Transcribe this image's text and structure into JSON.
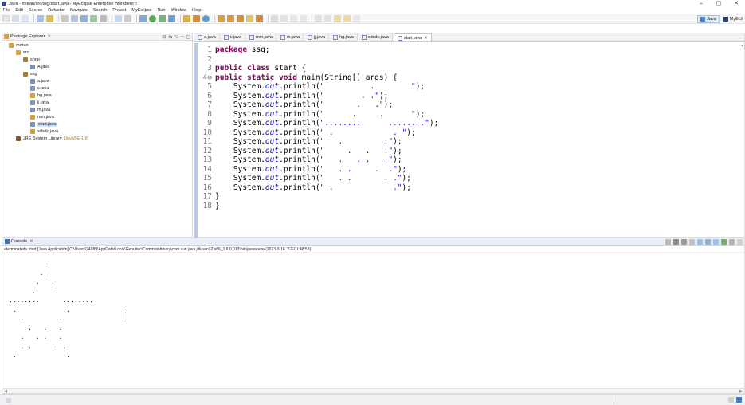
{
  "window": {
    "title": "Java - moran/src/ssg/start.java - MyEclipse Enterprise Workbench",
    "minimize_glyph": "–",
    "maximize_glyph": "▢",
    "close_glyph": "✕"
  },
  "menu": [
    "File",
    "Edit",
    "Source",
    "Refactor",
    "Navigate",
    "Search",
    "Project",
    "MyEclipse",
    "Run",
    "Window",
    "Help"
  ],
  "perspectives": [
    {
      "label": "Java",
      "icon": "java-perspective-icon",
      "active": true
    },
    {
      "label": "MyEcli",
      "icon": "myeclipse-perspective-icon",
      "active": false
    }
  ],
  "package_explorer": {
    "title": "Package Explorer",
    "close_glyph": "✕",
    "tools": [
      "⊟",
      "⇆",
      "▽",
      "–",
      "▢"
    ],
    "tree": [
      {
        "label": "moran",
        "icon": "project-icon",
        "depth": 0,
        "color": "#c9a23c"
      },
      {
        "label": "src",
        "icon": "source-folder-icon",
        "depth": 1,
        "color": "#d4a93d"
      },
      {
        "label": "shop",
        "icon": "package-icon",
        "depth": 2,
        "color": "#a37c3a"
      },
      {
        "label": "A.java",
        "icon": "java-file-icon",
        "depth": 3,
        "color": "#7a90b4"
      },
      {
        "label": "ssg",
        "icon": "package-icon",
        "depth": 2,
        "color": "#a37c3a"
      },
      {
        "label": "a.java",
        "icon": "java-file-icon",
        "depth": 3,
        "color": "#7a90b4"
      },
      {
        "label": "c.java",
        "icon": "java-file-icon",
        "depth": 3,
        "color": "#7a90b4"
      },
      {
        "label": "hg.java",
        "icon": "java-file-icon",
        "depth": 3,
        "color": "#c9a23c"
      },
      {
        "label": "jj.java",
        "icon": "java-file-icon",
        "depth": 3,
        "color": "#7a90b4"
      },
      {
        "label": "m.java",
        "icon": "java-file-icon",
        "depth": 3,
        "color": "#7a90b4"
      },
      {
        "label": "mm.java",
        "icon": "java-file-icon",
        "depth": 3,
        "color": "#c9a23c"
      },
      {
        "label": "start.java",
        "icon": "java-file-icon",
        "depth": 3,
        "color": "#7a90b4",
        "selected": true
      },
      {
        "label": "xdsdc.java",
        "icon": "java-file-icon",
        "depth": 3,
        "color": "#c9a23c"
      },
      {
        "label": "JRE System Library",
        "extra": "[JavaSE-1.6]",
        "icon": "library-icon",
        "depth": 1,
        "color": "#7d5b2e"
      }
    ]
  },
  "editor": {
    "tabs": [
      {
        "label": "a.java",
        "active": false
      },
      {
        "label": "c.java",
        "active": false
      },
      {
        "label": "mm.java",
        "active": false
      },
      {
        "label": "m.java",
        "active": false
      },
      {
        "label": "jj.java",
        "active": false
      },
      {
        "label": "hg.java",
        "active": false
      },
      {
        "label": "xdsdc.java",
        "active": false
      },
      {
        "label": "start.java",
        "active": true
      }
    ],
    "tab_close_glyph": "✕",
    "lines": [
      {
        "n": "1",
        "parts": [
          {
            "t": "package",
            "c": "kw"
          },
          {
            "t": " ssg;",
            "c": "plain"
          }
        ]
      },
      {
        "n": "2",
        "parts": []
      },
      {
        "n": "3",
        "parts": [
          {
            "t": "public class",
            "c": "kw"
          },
          {
            "t": " start {",
            "c": "plain"
          }
        ]
      },
      {
        "n": "4⊖",
        "parts": [
          {
            "t": "public static void",
            "c": "kw"
          },
          {
            "t": " main(String[] args) {",
            "c": "plain"
          }
        ]
      },
      {
        "n": "5",
        "parts": [
          {
            "t": "    System.",
            "c": "plain"
          },
          {
            "t": "out",
            "c": "fld"
          },
          {
            "t": ".println(",
            "c": "plain"
          },
          {
            "t": "\"          .        \"",
            "c": "str"
          },
          {
            "t": ");",
            "c": "plain"
          }
        ]
      },
      {
        "n": "6",
        "parts": [
          {
            "t": "    System.",
            "c": "plain"
          },
          {
            "t": "out",
            "c": "fld"
          },
          {
            "t": ".println(",
            "c": "plain"
          },
          {
            "t": "\"        . .\"",
            "c": "str"
          },
          {
            "t": ");",
            "c": "plain"
          }
        ]
      },
      {
        "n": "7",
        "parts": [
          {
            "t": "    System.",
            "c": "plain"
          },
          {
            "t": "out",
            "c": "fld"
          },
          {
            "t": ".println(",
            "c": "plain"
          },
          {
            "t": "\"       .   .\"",
            "c": "str"
          },
          {
            "t": ");",
            "c": "plain"
          }
        ]
      },
      {
        "n": "8",
        "parts": [
          {
            "t": "    System.",
            "c": "plain"
          },
          {
            "t": "out",
            "c": "fld"
          },
          {
            "t": ".println(",
            "c": "plain"
          },
          {
            "t": "\"      .     .      \"",
            "c": "str"
          },
          {
            "t": ");",
            "c": "plain"
          }
        ]
      },
      {
        "n": "9",
        "parts": [
          {
            "t": "    System.",
            "c": "plain"
          },
          {
            "t": "out",
            "c": "fld"
          },
          {
            "t": ".println(",
            "c": "plain"
          },
          {
            "t": "\"........      ........\"",
            "c": "str"
          },
          {
            "t": ");",
            "c": "plain"
          }
        ]
      },
      {
        "n": "10",
        "parts": [
          {
            "t": "    System.",
            "c": "plain"
          },
          {
            "t": "out",
            "c": "fld"
          },
          {
            "t": ".println(",
            "c": "plain"
          },
          {
            "t": "\" .             . \"",
            "c": "str"
          },
          {
            "t": ");",
            "c": "plain"
          }
        ]
      },
      {
        "n": "11",
        "parts": [
          {
            "t": "    System.",
            "c": "plain"
          },
          {
            "t": "out",
            "c": "fld"
          },
          {
            "t": ".println(",
            "c": "plain"
          },
          {
            "t": "\"   .         .\"",
            "c": "str"
          },
          {
            "t": ");",
            "c": "plain"
          }
        ]
      },
      {
        "n": "12",
        "parts": [
          {
            "t": "    System.",
            "c": "plain"
          },
          {
            "t": "out",
            "c": "fld"
          },
          {
            "t": ".println(",
            "c": "plain"
          },
          {
            "t": "\"     .   .   .\"",
            "c": "str"
          },
          {
            "t": ");",
            "c": "plain"
          }
        ]
      },
      {
        "n": "13",
        "parts": [
          {
            "t": "    System.",
            "c": "plain"
          },
          {
            "t": "out",
            "c": "fld"
          },
          {
            "t": ".println(",
            "c": "plain"
          },
          {
            "t": "\"   .   . .   .\"",
            "c": "str"
          },
          {
            "t": ");",
            "c": "plain"
          }
        ]
      },
      {
        "n": "14",
        "parts": [
          {
            "t": "    System.",
            "c": "plain"
          },
          {
            "t": "out",
            "c": "fld"
          },
          {
            "t": ".println(",
            "c": "plain"
          },
          {
            "t": "\"   . .     .  .\"",
            "c": "str"
          },
          {
            "t": ");",
            "c": "plain"
          }
        ]
      },
      {
        "n": "15",
        "parts": [
          {
            "t": "    System.",
            "c": "plain"
          },
          {
            "t": "out",
            "c": "fld"
          },
          {
            "t": ".println(",
            "c": "plain"
          },
          {
            "t": "\"   . .       . .\"",
            "c": "str"
          },
          {
            "t": ");",
            "c": "plain"
          }
        ]
      },
      {
        "n": "16",
        "parts": [
          {
            "t": "    System.",
            "c": "plain"
          },
          {
            "t": "out",
            "c": "fld"
          },
          {
            "t": ".println(",
            "c": "plain"
          },
          {
            "t": "\" .             .\"",
            "c": "str"
          },
          {
            "t": ");",
            "c": "plain"
          }
        ]
      },
      {
        "n": "17",
        "parts": [
          {
            "t": "}",
            "c": "plain"
          }
        ]
      },
      {
        "n": "18",
        "parts": [
          {
            "t": "}",
            "c": "plain"
          }
        ]
      }
    ]
  },
  "console": {
    "title": "Console",
    "close_glyph": "✕",
    "terminated": "<terminated> start [Java Application] C:\\Users\\24989\\AppData\\Local\\Genuitec\\Common\\binary\\com.sun.java.jdk.win32.x86_1.6.0.013\\bin\\javaw.exe (2023-3-18 下午01:48:58)",
    "output": [
      "          .",
      "        . .",
      "       .   .",
      "      .     .",
      "........      ........",
      " .             .",
      "   .         .",
      "     .   .   .",
      "   .   . .   .",
      "   . .     .  .",
      " .             ."
    ],
    "scroll_left_glyph": "◀",
    "scroll_right_glyph": "▶"
  },
  "status": {
    "icon": "status-icon"
  },
  "colors": {
    "accent": "#2a5cb8",
    "keyword": "#7f0055",
    "string": "#2a00ff",
    "field": "#0000c0"
  }
}
